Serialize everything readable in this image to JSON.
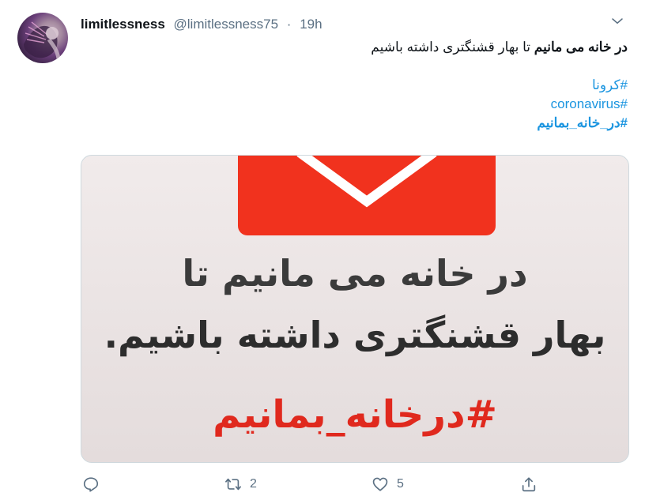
{
  "tweet": {
    "display_name": "limitlessness",
    "handle": "@limitlessness75",
    "separator": "·",
    "time": "19h",
    "text_bold": "در خانه می مانیم",
    "text_rest": " تا بهار قشنگتری داشته باشیم",
    "hashtags": [
      "#کرونا",
      "#coronavirus",
      "#در_خانه_بمانیم"
    ]
  },
  "media": {
    "line1": "در خانه می مانیم تا",
    "line2": "بهار قشنگتری داشته باشیم.",
    "line3": "#درخانه_بمانیم"
  },
  "actions": {
    "reply_icon": "reply-icon",
    "retweet_icon": "retweet-icon",
    "retweet_count": "2",
    "like_icon": "heart-icon",
    "like_count": "5",
    "share_icon": "share-icon"
  },
  "colors": {
    "accent": "#1b95e0",
    "secondary_text": "#5b7083",
    "envelope_red": "#f1321e",
    "hashtag_red": "#e0291e"
  }
}
